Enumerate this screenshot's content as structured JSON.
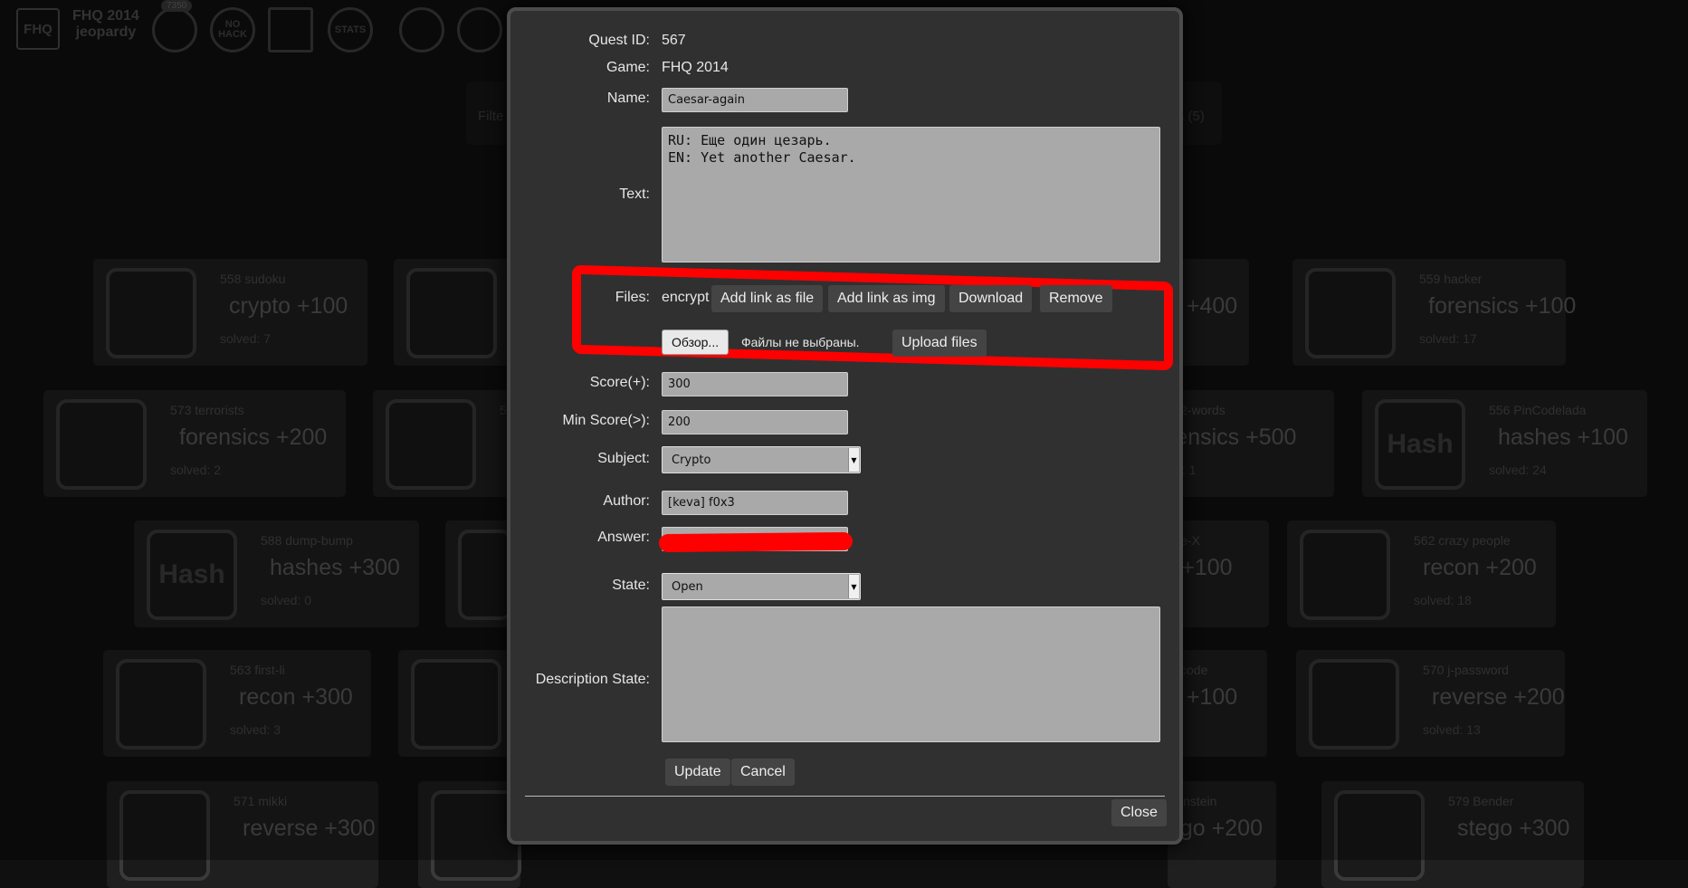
{
  "background": {
    "brand": {
      "line1": "FHQ 2014",
      "line2": "jeopardy"
    },
    "score_badge": "7350",
    "top_icons": [
      {
        "icon": "medal-icon",
        "text": ""
      },
      {
        "icon": "no-hack-icon",
        "text": "NO HACK"
      },
      {
        "icon": "qr-code-icon",
        "text": ""
      },
      {
        "icon": "stats-icon",
        "text": "STATS"
      },
      {
        "icon": "tools-icon",
        "text": ""
      },
      {
        "icon": "settings-icon",
        "text": ""
      }
    ],
    "filter_label": "Filte",
    "filter_right": "a (5)",
    "cards": [
      {
        "title": "558 sudoku",
        "score": "crypto +100",
        "solved": "solved: 7"
      },
      {
        "title": "",
        "score": "",
        "solved": ""
      },
      {
        "title": "",
        "score": "o +400",
        "solved": ""
      },
      {
        "title": "559 hacker",
        "score": "forensics +100",
        "solved": "solved: 17"
      },
      {
        "title": "573 terrorists",
        "score": "forensics +200",
        "solved": "solved: 2"
      },
      {
        "title": "5",
        "score": "s",
        "solved": ""
      },
      {
        "title": "2-words",
        "score": "rensics +500",
        "solved": "d: 1"
      },
      {
        "title": "556 PinCodelada",
        "score": "hashes +100",
        "solved": "solved: 24"
      },
      {
        "title": "588 dump-bump",
        "score": "hashes +300",
        "solved": "solved: 0"
      },
      {
        "title": "",
        "score": "",
        "solved": ""
      },
      {
        "title": "e-X",
        "score": ") +100",
        "solved": ""
      },
      {
        "title": "562 crazy people",
        "score": "recon +200",
        "solved": "solved: 18"
      },
      {
        "title": "563 first-li",
        "score": "recon +300",
        "solved": "solved: 3"
      },
      {
        "title": "",
        "score": "",
        "solved": ""
      },
      {
        "title": "code",
        "score": "e +100",
        "solved": ""
      },
      {
        "title": "570 j-password",
        "score": "reverse +200",
        "solved": "solved: 13"
      },
      {
        "title": "571 mikki",
        "score": "reverse +300",
        "solved": ""
      },
      {
        "title": "",
        "score": "",
        "solved": ""
      },
      {
        "title": "instein",
        "score": "ego +200",
        "solved": ""
      },
      {
        "title": "579 Bender",
        "score": "stego +300",
        "solved": ""
      }
    ],
    "hash_text": "Hash"
  },
  "modal": {
    "quest_id_label": "Quest ID:",
    "quest_id": "567",
    "game_label": "Game:",
    "game": "FHQ 2014",
    "name_label": "Name:",
    "name": "Caesar-again",
    "text_label": "Text:",
    "text": "RU: Еще один цезарь.\nEN: Yet another Caesar.",
    "files_label": "Files:",
    "file_name": "encrypt",
    "add_link_file": "Add link as file",
    "add_link_img": "Add link as img",
    "download": "Download",
    "remove": "Remove",
    "browse": "Обзор...",
    "no_files": "Файлы не выбраны.",
    "upload": "Upload files",
    "score_label": "Score(+):",
    "score": "300",
    "min_score_label": "Min Score(>):",
    "min_score": "200",
    "subject_label": "Subject:",
    "subject": "Crypto",
    "author_label": "Author:",
    "author": "[keva] f0x3",
    "answer_label": "Answer:",
    "answer": "",
    "state_label": "State:",
    "state": "Open",
    "description_state_label": "Description State:",
    "description_state": "",
    "update": "Update",
    "cancel": "Cancel",
    "close": "Close"
  },
  "colors": {
    "highlight_red": "#ff0000",
    "modal_bg": "#303030",
    "input_bg": "#a9a9a9"
  }
}
